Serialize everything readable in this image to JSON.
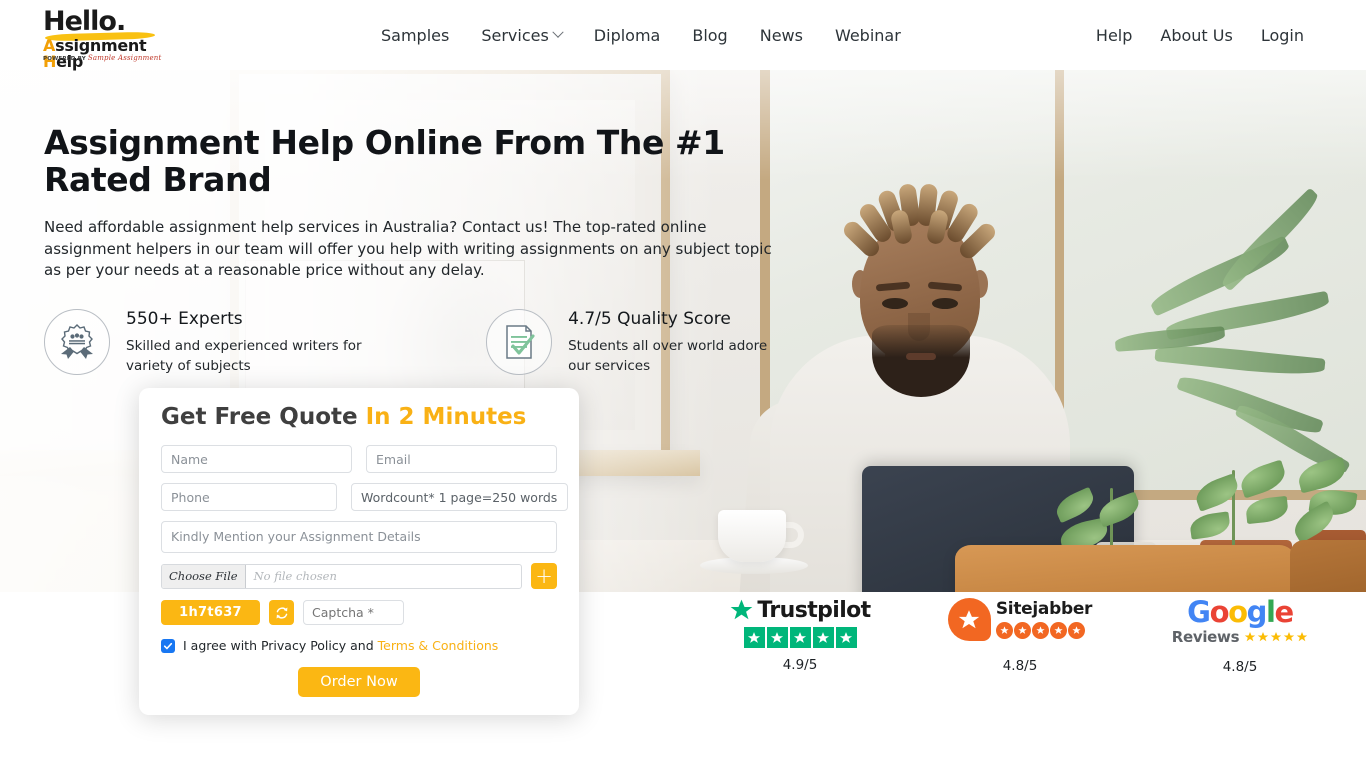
{
  "header": {
    "logo": {
      "line1": "Hello",
      "dot": ".",
      "line2_a": "A",
      "line2_b": "ssignment ",
      "line2_c": "H",
      "line2_d": "elp",
      "powered_by": "POWERED BY",
      "brand": "Sample Assignment"
    },
    "nav": [
      {
        "label": "Samples",
        "has_chevron": false
      },
      {
        "label": "Services",
        "has_chevron": true
      },
      {
        "label": "Diploma",
        "has_chevron": false
      },
      {
        "label": "Blog",
        "has_chevron": false
      },
      {
        "label": "News",
        "has_chevron": false
      },
      {
        "label": "Webinar",
        "has_chevron": false
      }
    ],
    "nav_right": [
      {
        "label": "Help"
      },
      {
        "label": "About Us"
      },
      {
        "label": "Login"
      }
    ]
  },
  "hero": {
    "title": "Assignment Help Online From The #1 Rated Brand",
    "subtitle": "Need affordable assignment help services in Australia? Contact us! The top-rated online assignment helpers in our team will offer you help with writing assignments on any subject topic as per your needs at a reasonable price without any delay.",
    "features": [
      {
        "icon": "award-ribbon-icon",
        "heading": "550+ Experts",
        "body": "Skilled and experienced writers for variety of subjects"
      },
      {
        "icon": "document-check-icon",
        "heading": "4.7/5 Quality Score",
        "body": "Students all over world adore our services"
      }
    ]
  },
  "form": {
    "title_main": "Get Free Quote",
    "title_highlight": "In 2 Minutes",
    "title_highlight_color": "#f9b115",
    "name_placeholder": "Name",
    "email_placeholder": "Email",
    "phone_placeholder": "Phone",
    "wordcount_selected": "Wordcount* 1 page=250 words",
    "details_placeholder": "Kindly Mention your Assignment Details",
    "file_button": "Choose File",
    "file_name": "No file chosen",
    "add_button": "+",
    "captcha_code": "1h7t637",
    "captcha_refresh_icon": "refresh-icon",
    "captcha_placeholder": "Captcha *",
    "agree_text": "I agree with Privacy Policy and",
    "terms_link": "Terms & Conditions",
    "agree_checked": true,
    "submit_label": "Order Now",
    "accent_color": "#fbb713"
  },
  "reviews": [
    {
      "name": "Trustpilot",
      "score": "4.9/5",
      "stars": 5,
      "star_color": "#00b67a"
    },
    {
      "name": "Sitejabber",
      "score": "4.8/5",
      "stars": 5,
      "star_color": "#f26722"
    },
    {
      "name": "Google",
      "sub_name": "Reviews",
      "score": "4.8/5",
      "stars": 5,
      "star_color": "#fbbc05",
      "letters": [
        "G",
        "o",
        "o",
        "g",
        "l",
        "e"
      ]
    }
  ]
}
